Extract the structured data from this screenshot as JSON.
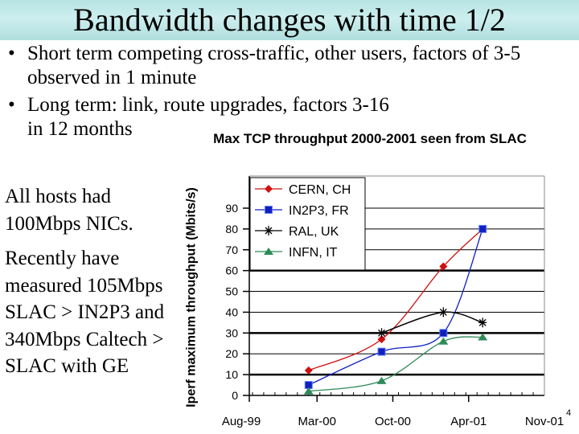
{
  "slide": {
    "title": "Bandwidth changes with time 1/2",
    "bullets": [
      "Short term competing cross-traffic, other users, factors of 3-5 observed in 1 minute",
      "Long term: link, route upgrades, factors 3-16 in 12 months"
    ],
    "bullet_glyph": "•",
    "side_notes": [
      "All hosts had 100Mbps NICs.",
      "Recently have measured 105Mbps SLAC > IN2P3 and 340Mbps Caltech > SLAC with GE"
    ],
    "page_number": "4"
  },
  "chart_data": {
    "type": "line",
    "title": "Max TCP throughput 2000-2001 seen from SLAC",
    "xlabel": "",
    "ylabel": "Iperf maximum throughput (Mbits/s)",
    "x_ticks": [
      "Aug-99",
      "Mar-00",
      "Oct-00",
      "Apr-01",
      "Nov-01"
    ],
    "x_range_months": [
      0,
      27
    ],
    "ylim": [
      0,
      90
    ],
    "y_ticks": [
      0,
      10,
      20,
      30,
      40,
      50,
      60,
      70,
      80,
      90
    ],
    "grid": true,
    "legend": "top-left",
    "series": [
      {
        "name": "CERN, CH",
        "color": "#d01010",
        "marker": "diamond",
        "x_months": [
          6,
          12.5,
          18,
          21.5
        ],
        "values": [
          12,
          27,
          62,
          80
        ]
      },
      {
        "name": "IN2P3, FR",
        "color": "#1020c0",
        "marker": "square",
        "x_months": [
          6,
          12.5,
          18,
          21.5
        ],
        "values": [
          5,
          21,
          30,
          80
        ]
      },
      {
        "name": "RAL, UK",
        "color": "#000000",
        "marker": "asterisk",
        "x_months": [
          12.5,
          18,
          21.5
        ],
        "values": [
          30,
          40,
          35
        ]
      },
      {
        "name": "INFN, IT",
        "color": "#2e8b57",
        "marker": "triangle",
        "x_months": [
          6,
          12.5,
          18,
          21.5
        ],
        "values": [
          2,
          7,
          26,
          28
        ]
      }
    ]
  }
}
